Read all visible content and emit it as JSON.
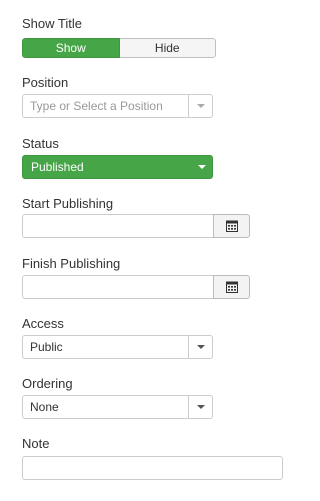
{
  "show_title": {
    "label": "Show Title",
    "options": [
      "Show",
      "Hide"
    ],
    "selected": "Show"
  },
  "position": {
    "label": "Position",
    "placeholder": "Type or Select a Position"
  },
  "status": {
    "label": "Status",
    "value": "Published",
    "color": "#46a546"
  },
  "start_publishing": {
    "label": "Start Publishing",
    "value": ""
  },
  "finish_publishing": {
    "label": "Finish Publishing",
    "value": ""
  },
  "access": {
    "label": "Access",
    "value": "Public"
  },
  "ordering": {
    "label": "Ordering",
    "value": "None"
  },
  "note": {
    "label": "Note",
    "value": ""
  }
}
